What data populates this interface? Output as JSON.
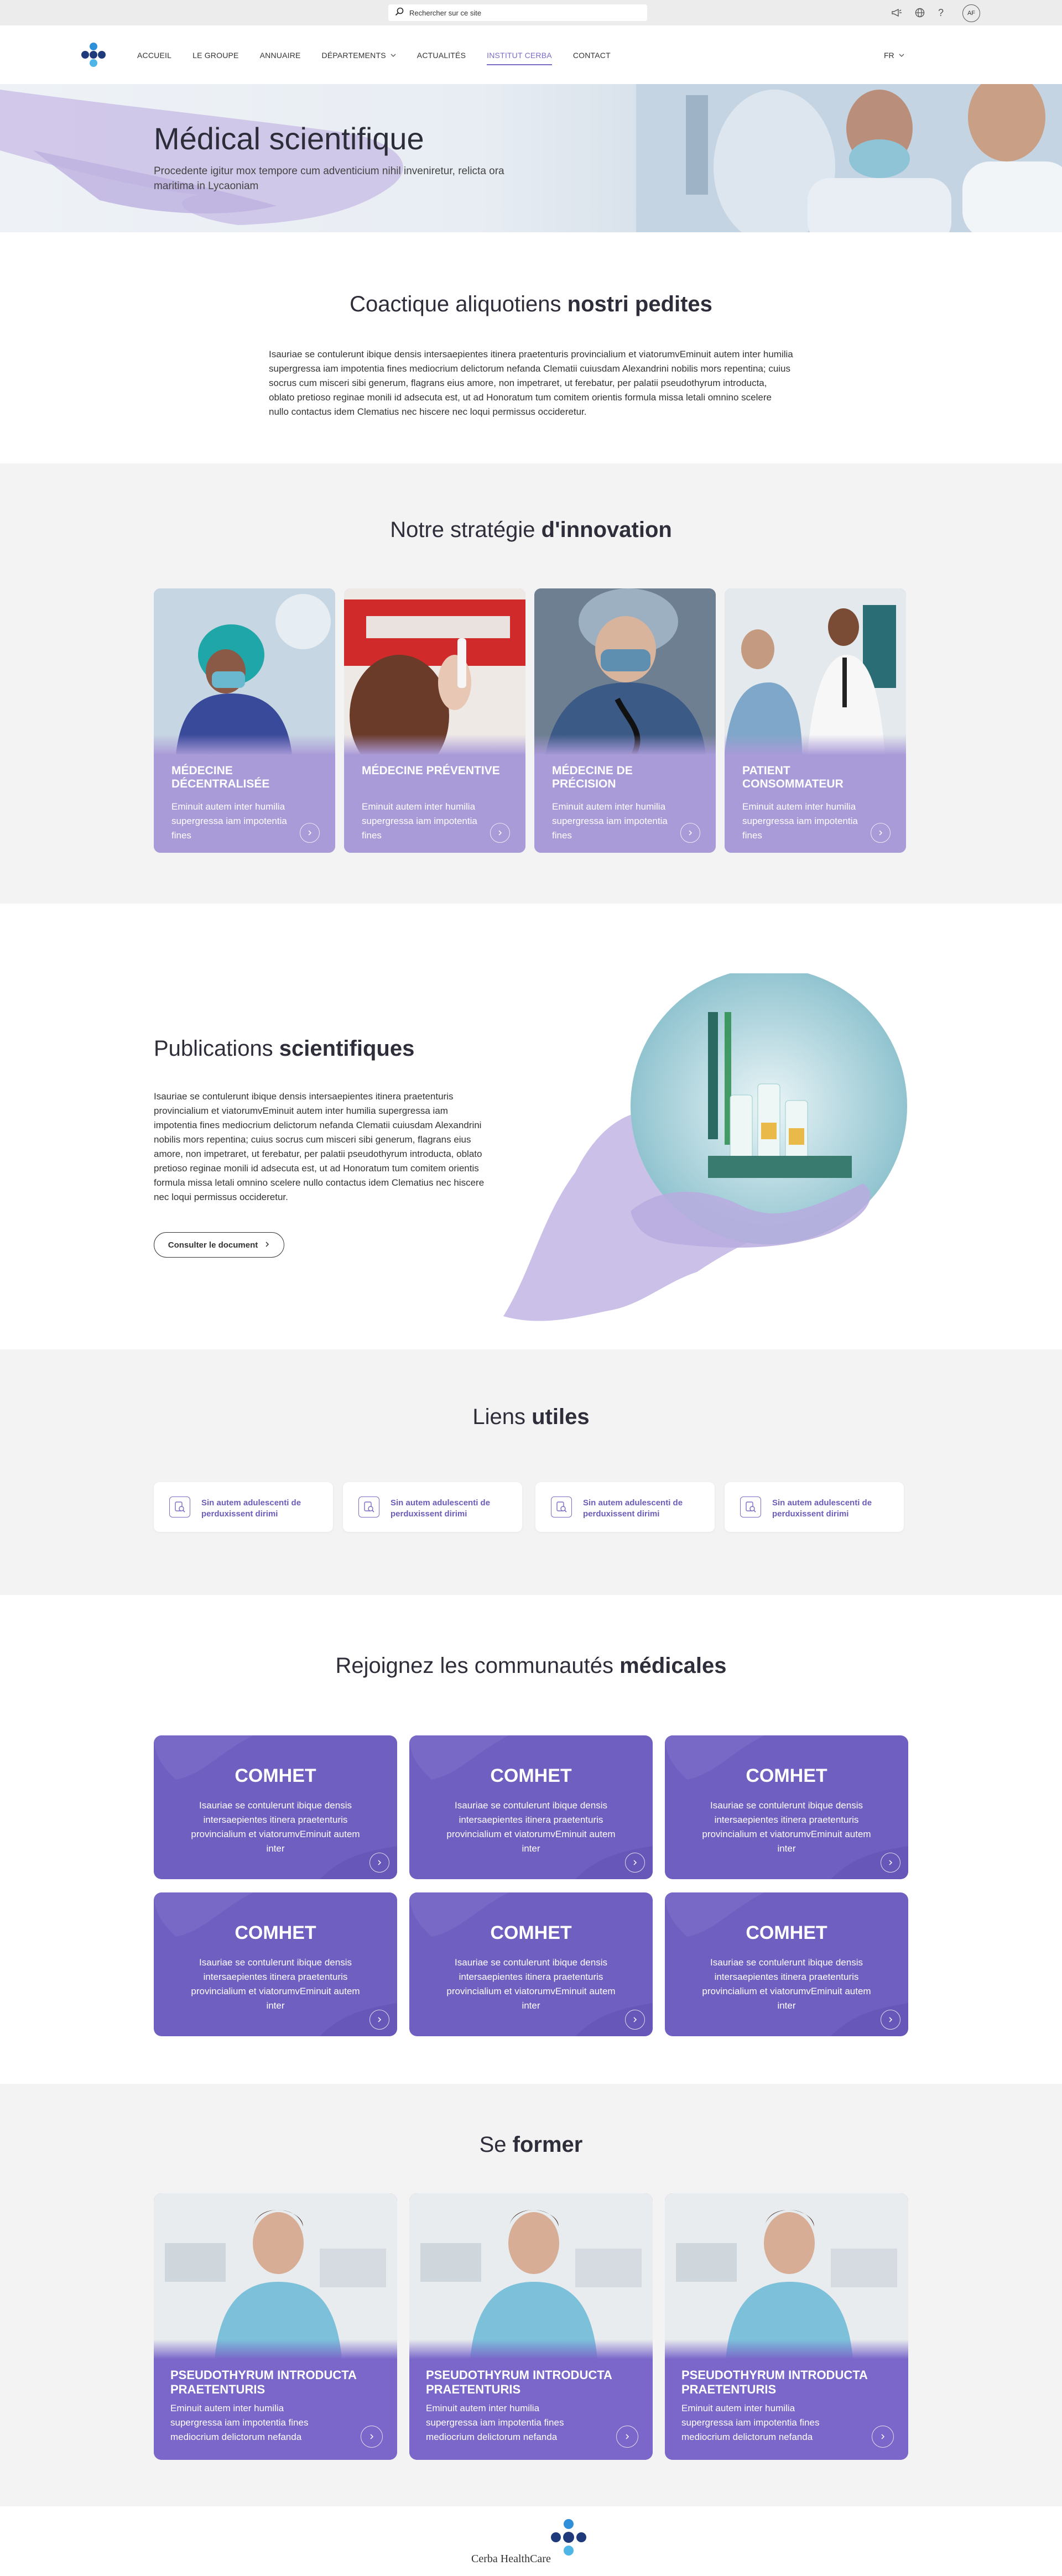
{
  "search": {
    "placeholder": "Rechercher sur ce site"
  },
  "user": {
    "initials": "AF"
  },
  "nav": {
    "items": [
      {
        "label": "Accueil"
      },
      {
        "label": "Le groupe"
      },
      {
        "label": "Annuaire"
      },
      {
        "label": "Départements"
      },
      {
        "label": "Actualités"
      },
      {
        "label": "Institut Cerba"
      },
      {
        "label": "Contact"
      }
    ],
    "active_index": 5,
    "lang": "FR"
  },
  "hero": {
    "title": "Médical scientifique",
    "subtitle": "Procedente igitur mox tempore cum adventicium nihil inveniretur, relicta ora maritima in Lycaoniam"
  },
  "intro": {
    "title_plain": "Coactique aliquotiens ",
    "title_bold": "nostri pedites",
    "text": "Isauriae se contulerunt ibique densis intersaepientes itinera praetenturis provincialium et viatorumvEminuit autem inter humilia supergressa iam impotentia fines mediocrium delictorum nefanda Clematii cuiusdam Alexandrini nobilis mors repentina; cuius socrus cum misceri sibi generum, flagrans eius amore, non impetraret, ut ferebatur, per palatii pseudothyrum introducta, oblato pretioso reginae monili id adsecuta est, ut ad Honoratum tum comitem orientis formula missa letali omnino scelere nullo contactus idem Clematius nec hiscere nec loqui permissus occideretur."
  },
  "strategy": {
    "title_plain": "Notre stratégie ",
    "title_bold": "d'innovation",
    "cards": [
      {
        "title": "Médecine décentralisée",
        "text": "Eminuit autem inter humilia supergressa iam impotentia fines"
      },
      {
        "title": "Médecine préventive",
        "text": "Eminuit autem inter humilia supergressa iam impotentia fines"
      },
      {
        "title": "Médecine de précision",
        "text": "Eminuit autem inter humilia supergressa iam impotentia fines"
      },
      {
        "title": "Patient consommateur",
        "text": "Eminuit autem inter humilia supergressa iam impotentia fines"
      }
    ]
  },
  "publications": {
    "title_plain": "Publications ",
    "title_bold": "scientifiques",
    "text": "Isauriae se contulerunt ibique densis intersaepientes itinera praetenturis provincialium et viatorumvEminuit autem inter humilia supergressa iam impotentia fines mediocrium delictorum nefanda Clematii cuiusdam Alexandrini nobilis mors repentina; cuius socrus cum misceri sibi generum, flagrans eius amore, non impetraret, ut ferebatur, per palatii pseudothyrum introducta, oblato pretioso reginae monili id adsecuta est, ut ad Honoratum tum comitem orientis formula missa letali omnino scelere nullo contactus idem Clematius nec hiscere nec loqui permissus occideretur.",
    "button": "Consulter le document"
  },
  "links": {
    "title_plain": "Liens ",
    "title_bold": "utiles",
    "items": [
      {
        "label": "Sin autem adulescenti de perduxissent dirimi"
      },
      {
        "label": "Sin autem adulescenti de perduxissent dirimi"
      },
      {
        "label": "Sin autem adulescenti de perduxissent dirimi"
      },
      {
        "label": "Sin autem adulescenti de perduxissent dirimi"
      }
    ]
  },
  "communities": {
    "title_plain": "Rejoignez les communautés ",
    "title_bold": "médicales",
    "cards": [
      {
        "title": "COMHET",
        "text": "Isauriae se contulerunt ibique densis intersaepientes itinera praetenturis provincialium et viatorumvEminuit autem inter"
      },
      {
        "title": "COMHET",
        "text": "Isauriae se contulerunt ibique densis intersaepientes itinera praetenturis provincialium et viatorumvEminuit autem inter"
      },
      {
        "title": "COMHET",
        "text": "Isauriae se contulerunt ibique densis intersaepientes itinera praetenturis provincialium et viatorumvEminuit autem inter"
      },
      {
        "title": "COMHET",
        "text": "Isauriae se contulerunt ibique densis intersaepientes itinera praetenturis provincialium et viatorumvEminuit autem inter"
      },
      {
        "title": "COMHET",
        "text": "Isauriae se contulerunt ibique densis intersaepientes itinera praetenturis provincialium et viatorumvEminuit autem inter"
      },
      {
        "title": "COMHET",
        "text": "Isauriae se contulerunt ibique densis intersaepientes itinera praetenturis provincialium et viatorumvEminuit autem inter"
      }
    ]
  },
  "training": {
    "title_plain": "Se ",
    "title_bold": "former",
    "cards": [
      {
        "title": "Pseudothyrum introducta praetenturis",
        "text": "Eminuit autem inter humilia supergressa iam impotentia fines mediocrium delictorum nefanda"
      },
      {
        "title": "Pseudothyrum introducta praetenturis",
        "text": "Eminuit autem inter humilia supergressa iam impotentia fines mediocrium delictorum nefanda"
      },
      {
        "title": "Pseudothyrum introducta praetenturis",
        "text": "Eminuit autem inter humilia supergressa iam impotentia fines mediocrium delictorum nefanda"
      }
    ]
  },
  "footer": {
    "brand": "Cerba HealthCare"
  },
  "colors": {
    "accent": "#7a6cc4",
    "lilac": "#a99ad8",
    "purple": "#6f5fc0",
    "navy": "#1e3a7a",
    "blue": "#2f8fd8"
  },
  "icons": [
    "search-icon",
    "megaphone-icon",
    "globe-icon",
    "help-icon",
    "chevron-down-icon",
    "arrow-right-icon",
    "document-link-icon",
    "cerba-cross-logo"
  ]
}
